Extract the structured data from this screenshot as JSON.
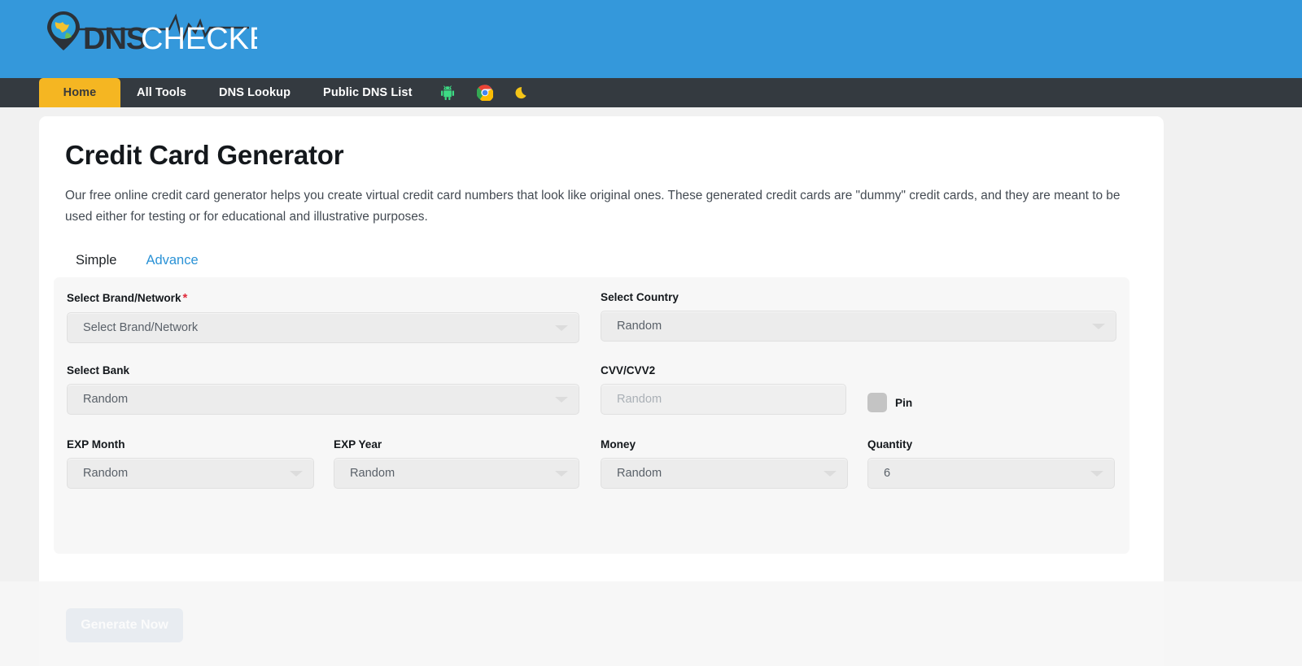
{
  "brand": {
    "logo_primary": "DNS",
    "logo_secondary": "CHECKER",
    "header_color": "#3498db",
    "navbar_color": "#343a40",
    "active_tab_color": "#f5b622",
    "accent_color": "#2a92d6"
  },
  "nav": {
    "items": [
      {
        "label": "Home",
        "active": true
      },
      {
        "label": "All Tools",
        "active": false
      },
      {
        "label": "DNS Lookup",
        "active": false
      },
      {
        "label": "Public DNS List",
        "active": false
      }
    ],
    "icons": [
      {
        "name": "android-icon",
        "color": "#3ddc84"
      },
      {
        "name": "chrome-icon",
        "color": "#4285f4"
      },
      {
        "name": "dark-mode-moon-icon",
        "color": "#f5c518"
      }
    ]
  },
  "page": {
    "title": "Credit Card Generator",
    "description": "Our free online credit card generator helps you create virtual credit card numbers that look like original ones. These generated credit cards are \"dummy\" credit cards, and they are meant to be used either for testing or for educational and illustrative purposes."
  },
  "tabs": [
    {
      "label": "Simple",
      "active": false
    },
    {
      "label": "Advance",
      "active": true
    }
  ],
  "form": {
    "brand_network": {
      "label": "Select Brand/Network",
      "required_marker": "*",
      "value": "Select Brand/Network"
    },
    "country": {
      "label": "Select Country",
      "value": "Random"
    },
    "bank": {
      "label": "Select Bank",
      "value": "Random"
    },
    "cvv": {
      "label": "CVV/CVV2",
      "placeholder": "Random",
      "value": ""
    },
    "pin": {
      "label": "Pin",
      "checked": false
    },
    "exp_month": {
      "label": "EXP Month",
      "value": "Random"
    },
    "exp_year": {
      "label": "EXP Year",
      "value": "Random"
    },
    "money": {
      "label": "Money",
      "value": "Random"
    },
    "quantity": {
      "label": "Quantity",
      "value": "6"
    }
  },
  "actions": {
    "generate_label": "Generate Now"
  }
}
